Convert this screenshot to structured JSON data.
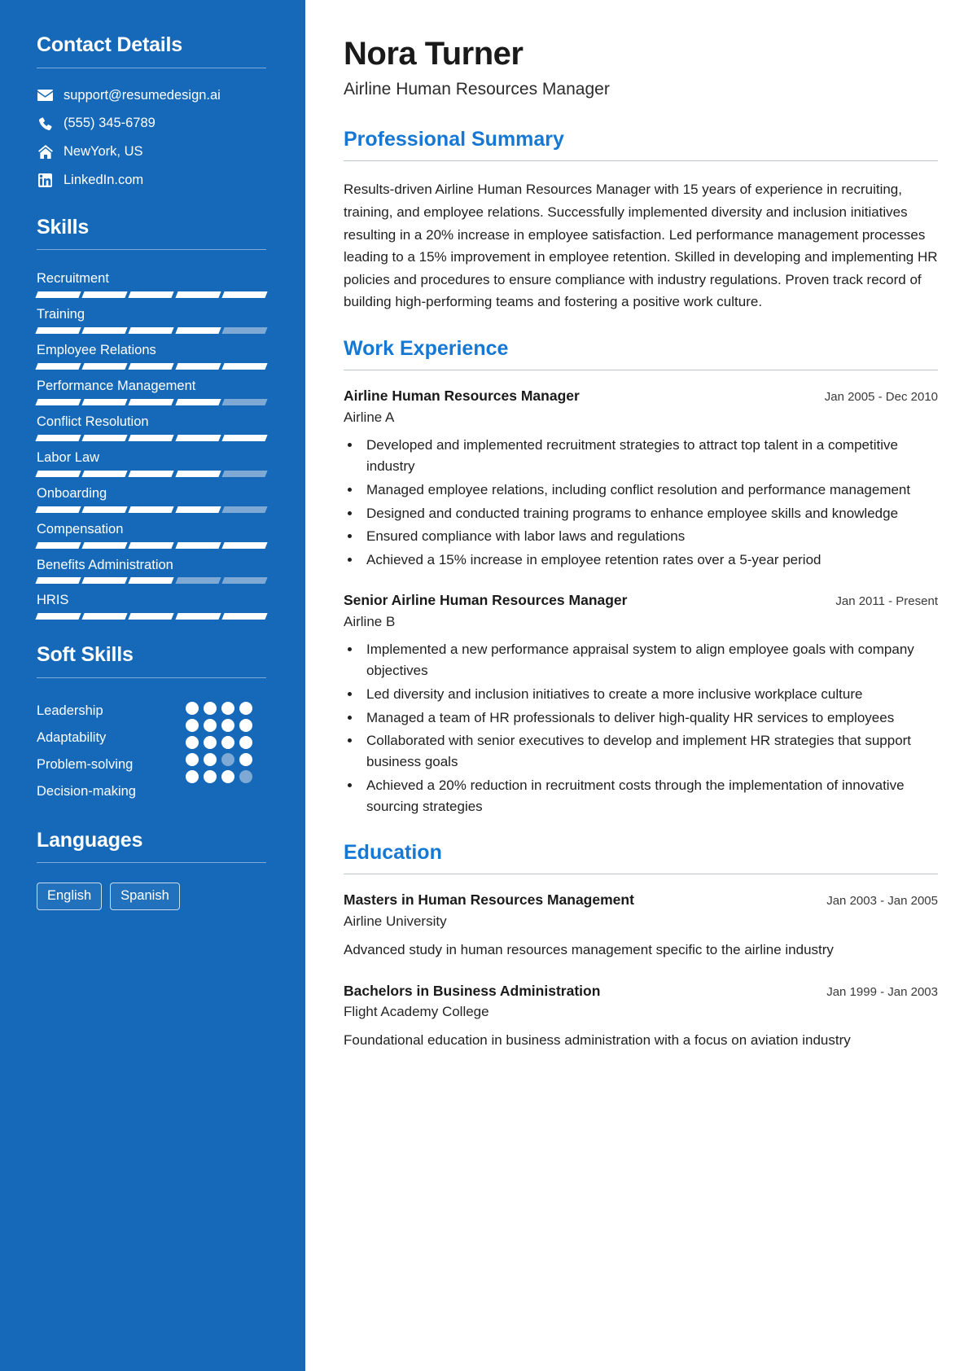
{
  "theme": {
    "sidebar_bg": "#1569b8",
    "accent": "#1478d4",
    "bar_on": "#ffffff",
    "bar_off": "#7da9d4"
  },
  "sidebar": {
    "contact": {
      "heading": "Contact Details",
      "items": [
        {
          "icon": "envelope-icon",
          "value": "support@resumedesign.ai"
        },
        {
          "icon": "phone-icon",
          "value": "(555) 345-6789"
        },
        {
          "icon": "home-icon",
          "value": "NewYork, US"
        },
        {
          "icon": "linkedin-icon",
          "value": "LinkedIn.com"
        }
      ]
    },
    "skills": {
      "heading": "Skills",
      "max": 5,
      "items": [
        {
          "label": "Recruitment",
          "level": 5
        },
        {
          "label": "Training",
          "level": 4
        },
        {
          "label": "Employee Relations",
          "level": 5
        },
        {
          "label": "Performance Management",
          "level": 4
        },
        {
          "label": "Conflict Resolution",
          "level": 5
        },
        {
          "label": "Labor Law",
          "level": 4
        },
        {
          "label": "Onboarding",
          "level": 4
        },
        {
          "label": "Compensation",
          "level": 5
        },
        {
          "label": "Benefits Administration",
          "level": 3
        },
        {
          "label": "HRIS",
          "level": 5
        }
      ]
    },
    "soft_skills": {
      "heading": "Soft Skills",
      "max": 5,
      "items": [
        {
          "label": "Leadership",
          "level": 5
        },
        {
          "label": "Adaptability",
          "level": 5
        },
        {
          "label": "Problem-solving",
          "level": 4
        },
        {
          "label": "Decision-making",
          "level": 4
        }
      ]
    },
    "languages": {
      "heading": "Languages",
      "items": [
        "English",
        "Spanish"
      ]
    }
  },
  "main": {
    "name": "Nora Turner",
    "title": "Airline Human Resources Manager",
    "summary": {
      "heading": "Professional Summary",
      "text": "Results-driven Airline Human Resources Manager with 15 years of experience in recruiting, training, and employee relations. Successfully implemented diversity and inclusion initiatives resulting in a 20% increase in employee satisfaction. Led performance management processes leading to a 15% improvement in employee retention. Skilled in developing and implementing HR policies and procedures to ensure compliance with industry regulations. Proven track record of building high-performing teams and fostering a positive work culture."
    },
    "experience": {
      "heading": "Work Experience",
      "entries": [
        {
          "role": "Airline Human Resources Manager",
          "org": "Airline A",
          "date": "Jan 2005 - Dec 2010",
          "bullets": [
            "Developed and implemented recruitment strategies to attract top talent in a competitive industry",
            "Managed employee relations, including conflict resolution and performance management",
            "Designed and conducted training programs to enhance employee skills and knowledge",
            "Ensured compliance with labor laws and regulations",
            "Achieved a 15% increase in employee retention rates over a 5-year period"
          ]
        },
        {
          "role": "Senior Airline Human Resources Manager",
          "org": "Airline B",
          "date": "Jan 2011 - Present",
          "bullets": [
            "Implemented a new performance appraisal system to align employee goals with company objectives",
            "Led diversity and inclusion initiatives to create a more inclusive workplace culture",
            "Managed a team of HR professionals to deliver high-quality HR services to employees",
            "Collaborated with senior executives to develop and implement HR strategies that support business goals",
            "Achieved a 20% reduction in recruitment costs through the implementation of innovative sourcing strategies"
          ]
        }
      ]
    },
    "education": {
      "heading": "Education",
      "entries": [
        {
          "role": "Masters in Human Resources Management",
          "org": "Airline University",
          "date": "Jan 2003 - Jan 2005",
          "desc": "Advanced study in human resources management specific to the airline industry"
        },
        {
          "role": "Bachelors in Business Administration",
          "org": "Flight Academy College",
          "date": "Jan 1999 - Jan 2003",
          "desc": "Foundational education in business administration with a focus on aviation industry"
        }
      ]
    }
  }
}
